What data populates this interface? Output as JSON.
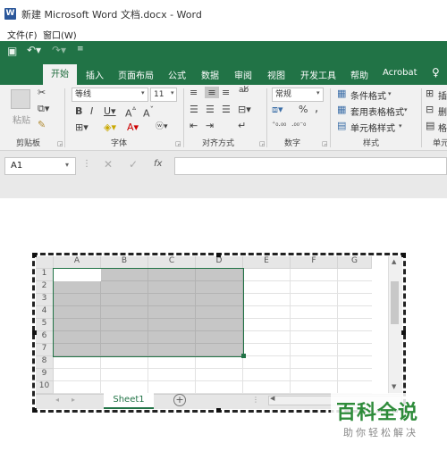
{
  "window": {
    "title": "新建 Microsoft Word 文档.docx - Word"
  },
  "menubar": {
    "items": [
      "文件(F)",
      "窗口(W)"
    ]
  },
  "ribbon_tabs": [
    "开始",
    "插入",
    "页面布局",
    "公式",
    "数据",
    "审阅",
    "视图",
    "开发工具",
    "帮助",
    "Acrobat"
  ],
  "ribbon": {
    "clipboard": {
      "label": "剪贴板",
      "paste": "粘贴"
    },
    "font": {
      "label": "字体",
      "name": "等线",
      "size": "11"
    },
    "alignment": {
      "label": "对齐方式"
    },
    "number": {
      "label": "数字",
      "format": "常规",
      "percent": "%",
      "comma": ","
    },
    "styles": {
      "label": "样式",
      "conditional": "条件格式",
      "table_format": "套用表格格式",
      "cell_styles": "单元格样式"
    },
    "cells": {
      "label": "单元",
      "insert": "插",
      "delete": "删",
      "format": "格"
    }
  },
  "formula_bar": {
    "name_box": "A1",
    "fx": "fx"
  },
  "sheet": {
    "columns": [
      "A",
      "B",
      "C",
      "D",
      "E",
      "F",
      "G"
    ],
    "rows": [
      "1",
      "2",
      "3",
      "4",
      "5",
      "6",
      "7",
      "8",
      "9",
      "10"
    ],
    "tab": "Sheet1",
    "selection": "A1:D7"
  },
  "watermark": {
    "title": "百科全说",
    "subtitle": "助你轻松解决"
  },
  "colors": {
    "excel_green": "#217346",
    "selection_gray": "#c6c6c6"
  }
}
